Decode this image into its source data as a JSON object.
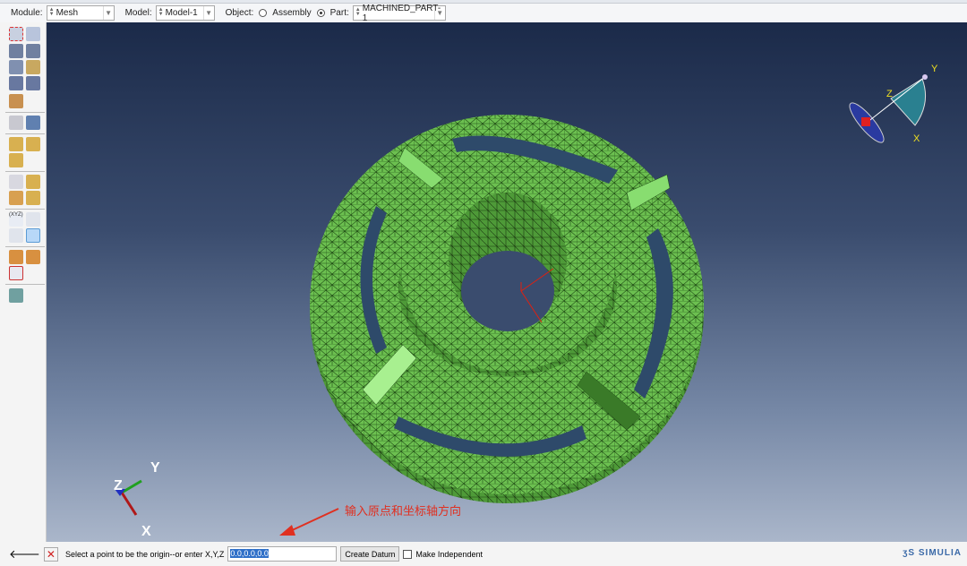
{
  "context_bar": {
    "module_label": "Module:",
    "module_value": "Mesh",
    "model_label": "Model:",
    "model_value": "Model-1",
    "object_label": "Object:",
    "assembly_label": "Assembly",
    "part_label": "Part:",
    "part_value": "MACHINED_PART-1",
    "object_selected": "Part"
  },
  "viewport": {
    "triad": {
      "x": "X",
      "y": "Y",
      "z": "Z"
    },
    "view_indicator": {
      "x": "X",
      "y": "Y",
      "z": "Z"
    },
    "annotation": "输入原点和坐标轴方向",
    "logo": "SIMULIA"
  },
  "prompt": {
    "text": "Select a point to be the origin--or enter X,Y,Z",
    "input_value": "0.0,0.0,0.0",
    "create_button": "Create Datum",
    "make_independent": "Make Independent",
    "make_independent_checked": false
  },
  "colors": {
    "mesh_green": "#6cc050",
    "annotation_red": "#e03020"
  }
}
